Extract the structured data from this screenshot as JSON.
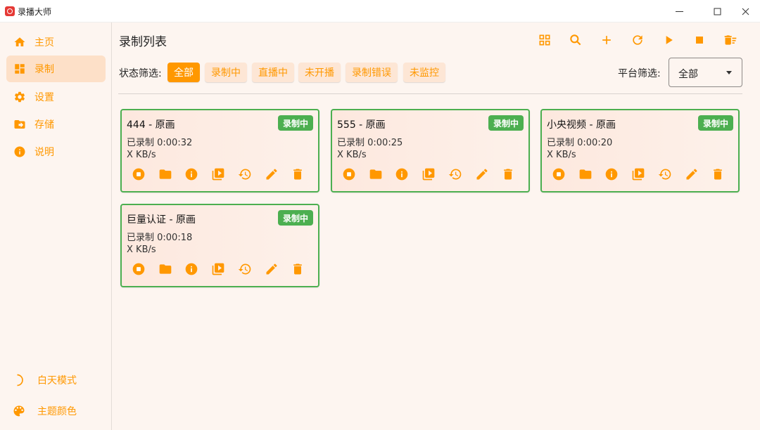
{
  "app": {
    "title": "录播大师"
  },
  "sidebar": {
    "items": [
      {
        "label": "主页",
        "icon": "home-icon"
      },
      {
        "label": "录制",
        "icon": "dashboard-icon"
      },
      {
        "label": "设置",
        "icon": "gear-icon"
      },
      {
        "label": "存储",
        "icon": "folder-move-icon"
      },
      {
        "label": "说明",
        "icon": "info-icon"
      }
    ],
    "active_index": 1,
    "bottom": [
      {
        "label": "白天模式",
        "icon": "moon-icon"
      },
      {
        "label": "主题颜色",
        "icon": "palette-icon"
      }
    ]
  },
  "main": {
    "title": "录制列表",
    "toolbar": [
      "grid-view-icon",
      "search-icon",
      "add-icon",
      "refresh-icon",
      "play-icon",
      "stop-icon",
      "delete-sweep-icon"
    ],
    "status_filter": {
      "label": "状态筛选:",
      "options": [
        "全部",
        "录制中",
        "直播中",
        "未开播",
        "录制错误",
        "未监控"
      ],
      "selected": "全部"
    },
    "platform_filter": {
      "label": "平台筛选:",
      "value": "全部"
    },
    "cards": [
      {
        "title": "444 - 原画",
        "badge": "录制中",
        "duration": "已录制 0:00:32",
        "speed": "X KB/s"
      },
      {
        "title": "555 - 原画",
        "badge": "录制中",
        "duration": "已录制 0:00:25",
        "speed": "X KB/s"
      },
      {
        "title": "小央视频 - 原画",
        "badge": "录制中",
        "duration": "已录制 0:00:20",
        "speed": "X KB/s"
      },
      {
        "title": "巨量认证 - 原画",
        "badge": "录制中",
        "duration": "已录制 0:00:18",
        "speed": "X KB/s"
      }
    ],
    "card_actions": [
      "stop-circle-icon",
      "folder-icon",
      "info-icon",
      "video-library-icon",
      "history-icon",
      "edit-icon",
      "delete-icon"
    ]
  },
  "colors": {
    "accent": "#ff9800",
    "recording": "#4caf50",
    "background": "#fdf5f0"
  }
}
